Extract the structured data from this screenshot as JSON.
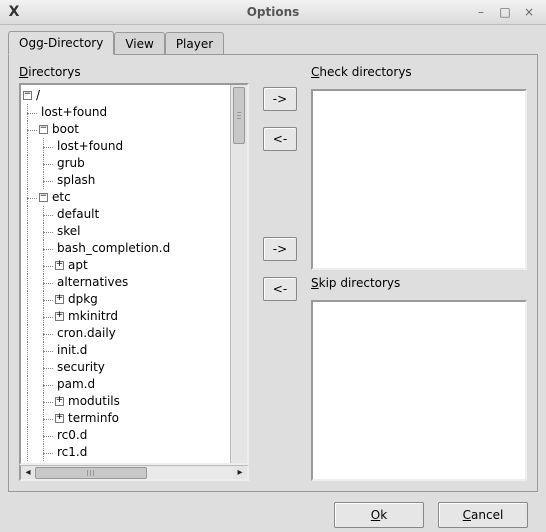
{
  "window": {
    "app_icon_label": "X",
    "title": "Options"
  },
  "tabs": [
    {
      "label": "Ogg-Directory",
      "active": true
    },
    {
      "label": "View",
      "active": false
    },
    {
      "label": "Player",
      "active": false
    }
  ],
  "left": {
    "section_label_pre": "",
    "section_label_u": "D",
    "section_label_post": "irectorys",
    "tree": [
      {
        "depth": 0,
        "expander": "minus",
        "label": "/"
      },
      {
        "depth": 1,
        "expander": "",
        "label": "lost+found"
      },
      {
        "depth": 1,
        "expander": "minus",
        "label": "boot"
      },
      {
        "depth": 2,
        "expander": "",
        "label": "lost+found"
      },
      {
        "depth": 2,
        "expander": "",
        "label": "grub"
      },
      {
        "depth": 2,
        "expander": "",
        "label": "splash"
      },
      {
        "depth": 1,
        "expander": "minus",
        "label": "etc"
      },
      {
        "depth": 2,
        "expander": "",
        "label": "default"
      },
      {
        "depth": 2,
        "expander": "",
        "label": "skel"
      },
      {
        "depth": 2,
        "expander": "",
        "label": "bash_completion.d"
      },
      {
        "depth": 2,
        "expander": "plus",
        "label": "apt"
      },
      {
        "depth": 2,
        "expander": "",
        "label": "alternatives"
      },
      {
        "depth": 2,
        "expander": "plus",
        "label": "dpkg"
      },
      {
        "depth": 2,
        "expander": "plus",
        "label": "mkinitrd"
      },
      {
        "depth": 2,
        "expander": "",
        "label": "cron.daily"
      },
      {
        "depth": 2,
        "expander": "",
        "label": "init.d"
      },
      {
        "depth": 2,
        "expander": "",
        "label": "security"
      },
      {
        "depth": 2,
        "expander": "",
        "label": "pam.d"
      },
      {
        "depth": 2,
        "expander": "plus",
        "label": "modutils"
      },
      {
        "depth": 2,
        "expander": "plus",
        "label": "terminfo"
      },
      {
        "depth": 2,
        "expander": "",
        "label": "rc0.d"
      },
      {
        "depth": 2,
        "expander": "",
        "label": "rc1.d"
      }
    ]
  },
  "mid": {
    "add_check_label": "->",
    "remove_check_label": "<-",
    "add_skip_label": "->",
    "remove_skip_label": "<-"
  },
  "right": {
    "check_label_pre": "",
    "check_label_u": "C",
    "check_label_post": "heck directorys",
    "skip_label_pre": "",
    "skip_label_u": "S",
    "skip_label_post": "kip directorys"
  },
  "buttons": {
    "ok_u": "O",
    "ok_post": "k",
    "cancel_u": "C",
    "cancel_post": "ancel"
  }
}
